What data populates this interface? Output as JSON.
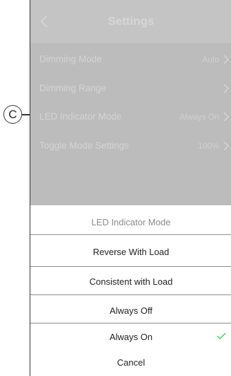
{
  "annotation": {
    "callout_letter": "C"
  },
  "header": {
    "title": "Settings"
  },
  "settings_rows": [
    {
      "label": "Dimming Mode",
      "value": "Auto"
    },
    {
      "label": "Dimming Range",
      "value": ""
    },
    {
      "label": "LED Indicator Mode",
      "value": "Always On"
    },
    {
      "label": "Toggle Mode Settings",
      "value": "100%"
    }
  ],
  "sheet": {
    "title": "LED Indicator Mode",
    "options": [
      {
        "label": "Reverse With Load",
        "selected": false
      },
      {
        "label": "Consistent with Load",
        "selected": false
      },
      {
        "label": "Always Off",
        "selected": false
      },
      {
        "label": "Always On",
        "selected": true
      }
    ],
    "cancel_label": "Cancel"
  },
  "colors": {
    "check_accent": "#3dcd58",
    "overlay": "#bcbcbc"
  }
}
